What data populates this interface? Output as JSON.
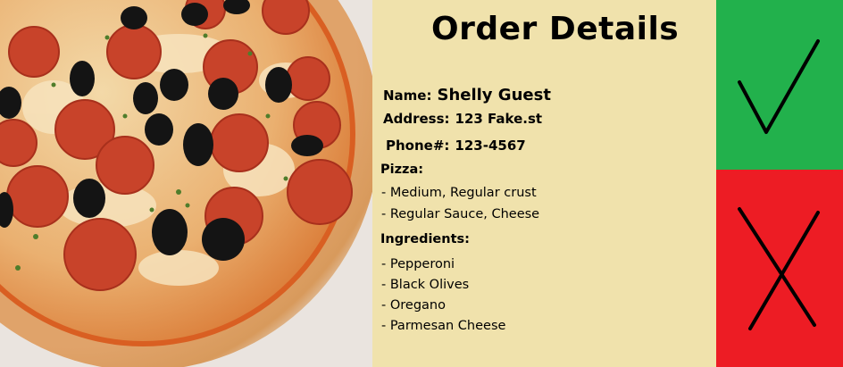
{
  "order": {
    "title": "Order Details",
    "name_label": "Name:",
    "name_value": "Shelly Guest",
    "address_label": "Address:",
    "address_value": "123 Fake.st",
    "phone_label": "Phone#:",
    "phone_value": "123-4567",
    "pizza_heading": "Pizza:",
    "pizza_lines": [
      "- Medium, Regular crust",
      "- Regular Sauce, Cheese"
    ],
    "ingredients_heading": "Ingredients:",
    "ingredients": [
      "- Pepperoni",
      "- Black Olives",
      "- Oregano",
      "- Parmesan Cheese"
    ]
  },
  "actions": {
    "accept_icon": "checkmark-icon",
    "reject_icon": "x-icon",
    "accept_color": "#22b14c",
    "reject_color": "#ed1c24"
  },
  "colors": {
    "panel_background": "#f0e2ac"
  }
}
